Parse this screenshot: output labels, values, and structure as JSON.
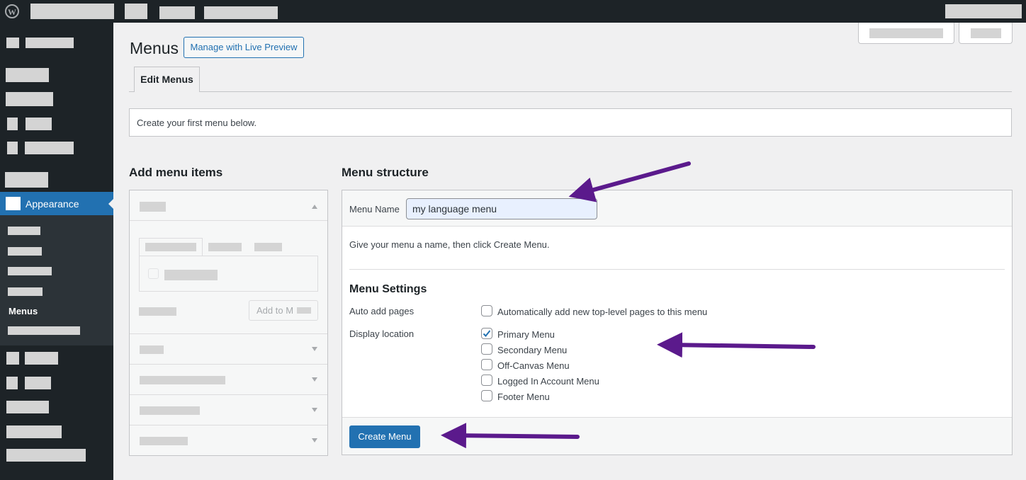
{
  "page": {
    "title": "Menus",
    "live_preview": "Manage with Live Preview",
    "tab": "Edit Menus",
    "notice": "Create your first menu below."
  },
  "sidebar": {
    "active": "Appearance",
    "current_sub": "Menus"
  },
  "add_items": {
    "heading": "Add menu items",
    "add_button": "Add to M"
  },
  "structure": {
    "heading": "Menu structure",
    "name_label": "Menu Name",
    "name_value": "my language menu",
    "hint": "Give your menu a name, then click Create Menu.",
    "settings_heading": "Menu Settings",
    "auto_add_label": "Auto add pages",
    "auto_add_option": "Automatically add new top-level pages to this menu",
    "display_label": "Display location",
    "locations": [
      {
        "label": "Primary Menu",
        "checked": true
      },
      {
        "label": "Secondary Menu",
        "checked": false
      },
      {
        "label": "Off-Canvas Menu",
        "checked": false
      },
      {
        "label": "Logged In Account Menu",
        "checked": false
      },
      {
        "label": "Footer Menu",
        "checked": false
      }
    ],
    "create_button": "Create Menu"
  },
  "colors": {
    "accent": "#2271b1",
    "annotation": "#5b1a8c",
    "sidebar": "#1d2327"
  }
}
